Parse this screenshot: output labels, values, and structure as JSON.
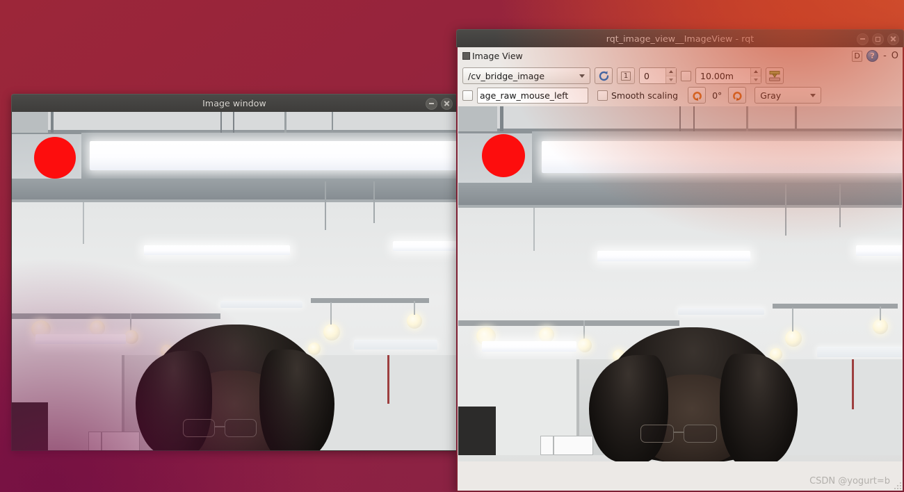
{
  "desktop": {
    "wallpaper_colors": {
      "top_right": "#cd4224",
      "center": "#96243c",
      "bottom_left": "#700e42"
    }
  },
  "left_window": {
    "title": "Image window",
    "controls": [
      {
        "name": "minimize",
        "glyph": "minimize-icon"
      },
      {
        "name": "close",
        "glyph": "close-icon"
      }
    ],
    "image": {
      "description": "Ceiling with fluorescent light fixtures and a person's head at bottom",
      "overlay_circle_color": "#fd0d0d"
    }
  },
  "rqt_window": {
    "title": "rqt_image_view__ImageView - rqt",
    "controls": [
      {
        "name": "minimize",
        "glyph": "minimize-icon"
      },
      {
        "name": "maximize",
        "glyph": "maximize-icon"
      },
      {
        "name": "close",
        "glyph": "close-icon"
      }
    ],
    "dock": {
      "icon": "image-view-icon",
      "title": "Image View",
      "detach_label": "D",
      "help_label": "?",
      "minimize_label": "-",
      "close_label": "O"
    },
    "toolbar": {
      "topic": {
        "value": "/cv_bridge_image",
        "options": [
          "/cv_bridge_image"
        ]
      },
      "refresh_button": "refresh-topics",
      "zoom_button_label": "1",
      "index_spin": {
        "value": "0"
      },
      "max_range_checkbox": {
        "checked": false
      },
      "max_range_spin": {
        "value": "10.00m"
      },
      "save_button": "save-image",
      "publish_click_checkbox": {
        "checked": false
      },
      "mouse_topic_field": {
        "value": "age_raw_mouse_left"
      },
      "smooth_scaling_checkbox": {
        "checked": false,
        "label": "Smooth scaling"
      },
      "rotate_left_button": "rotate-left",
      "rotation_label": "0°",
      "rotate_right_button": "rotate-right",
      "color_scheme": {
        "value": "Gray",
        "options": [
          "Gray"
        ]
      }
    },
    "image": {
      "description": "Same ceiling scene rendered in the rqt image view with a red circle overlay",
      "overlay_circle_color": "#fd0d0d"
    },
    "statusbar": {
      "watermark": "CSDN @yogurt=b"
    }
  }
}
